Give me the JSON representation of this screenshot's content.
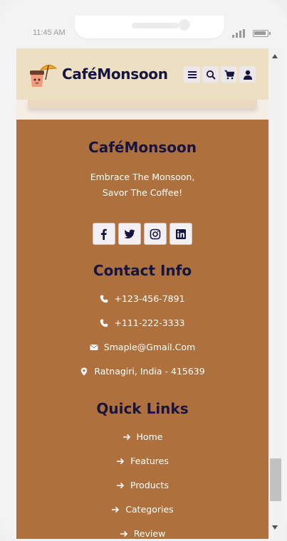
{
  "status_bar": {
    "time": "11:45 AM"
  },
  "header": {
    "brand": "CaféMonsoon",
    "icons": [
      "menu-icon",
      "search-icon",
      "cart-icon",
      "user-icon"
    ]
  },
  "footer": {
    "brand": "CaféMonsoon",
    "tagline_line1": "Embrace The Monsoon,",
    "tagline_line2": "Savor The Coffee!",
    "social": [
      "facebook-icon",
      "twitter-icon",
      "instagram-icon",
      "linkedin-icon"
    ],
    "contact_title": "Contact Info",
    "contact": {
      "phone1": "+123-456-7891",
      "phone2": "+111-222-3333",
      "email": "Smaple@Gmail.Com",
      "address": "Ratnagiri, India - 415639"
    },
    "links_title": "Quick Links",
    "links": [
      "Home",
      "Features",
      "Products",
      "Categories",
      "Review"
    ]
  },
  "colors": {
    "navbar": "#ecdfc2",
    "footer": "#ae713e",
    "heading": "#17143f"
  }
}
